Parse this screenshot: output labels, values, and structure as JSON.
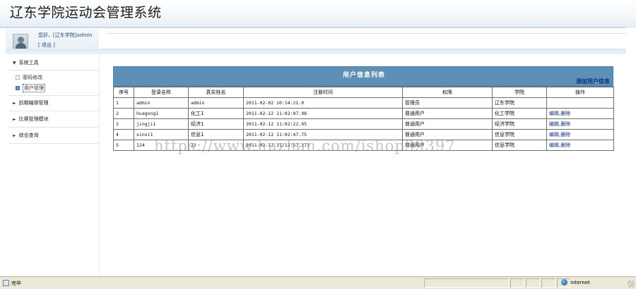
{
  "app": {
    "title": "辽东学院运动会管理系统"
  },
  "user": {
    "greeting": "您好，[辽东学院]admin",
    "logout": "[ 退出 ]"
  },
  "sidebar": {
    "sections": [
      {
        "label": "系统工具",
        "expanded": true,
        "items": [
          {
            "label": "密码修改"
          },
          {
            "label": "用户管理",
            "selected": true
          }
        ]
      },
      {
        "label": "前期编排管理"
      },
      {
        "label": "比赛管理模块"
      },
      {
        "label": "综合查询"
      }
    ]
  },
  "content": {
    "title": "用户信息列表",
    "add_label": "添加用户信息",
    "columns": [
      "序号",
      "登录名称",
      "真实姓名",
      "注册时间",
      "权限",
      "学院",
      "操作"
    ],
    "rows": [
      {
        "no": "1",
        "login": "admin",
        "name": "admin",
        "time": "2011-02-02 10:14:21.0",
        "role": "管理员",
        "college": "辽东学院",
        "edit": "",
        "sep": "",
        "del": ""
      },
      {
        "no": "2",
        "login": "huagong1",
        "name": "化工1",
        "time": "2011-02-12 11:02:07.98",
        "role": "普通用户",
        "college": "化工学院",
        "edit": "编辑",
        "sep": ",",
        "del": "删除"
      },
      {
        "no": "3",
        "login": "jingji1",
        "name": "经济1",
        "time": "2011-02-12 11:02:22.95",
        "role": "普通用户",
        "college": "经济学院",
        "edit": "编辑",
        "sep": ",",
        "del": "删除"
      },
      {
        "no": "4",
        "login": "xinxi1",
        "name": "信息1",
        "time": "2011-02-12 11:02:47.75",
        "role": "普通用户",
        "college": "信息学院",
        "edit": "编辑",
        "sep": ",",
        "del": "删除"
      },
      {
        "no": "5",
        "login": "124",
        "name": "12",
        "time": "2011-02-12 11:12:57.373",
        "role": "普通用户",
        "college": "信息学院",
        "edit": "编辑",
        "sep": ",",
        "del": "删除"
      }
    ]
  },
  "watermark": "https://www.huzhan.com/ishop39397",
  "status": {
    "text": "完毕",
    "zone": "Internet"
  },
  "colors": {
    "panel_header": "#5e8fb7",
    "link": "#0f2d78",
    "statusbar": "#ece9d8"
  }
}
